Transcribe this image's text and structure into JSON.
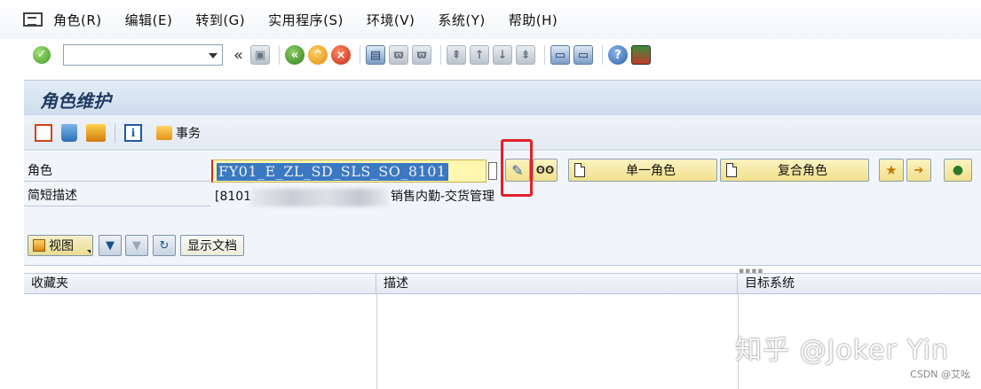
{
  "menubar": {
    "items": [
      "角色(R)",
      "编辑(E)",
      "转到(G)",
      "实用程序(S)",
      "环境(V)",
      "系统(Y)",
      "帮助(H)"
    ]
  },
  "toolbar": {
    "command_value": "",
    "chevron": "«"
  },
  "page": {
    "title": "角色维护"
  },
  "app_toolbar": {
    "transaction_label": "事务"
  },
  "form": {
    "role_label": "角色",
    "role_value": "FY01_E_ZL_SD_SLS_SO_8101",
    "desc_label": "简短描述",
    "desc_prefix": "[8101",
    "desc_suffix": "销售内勤-交货管理",
    "single_role_button": "单一角色",
    "composite_role_button": "复合角色"
  },
  "view_bar": {
    "view_button": "视图",
    "show_doc_button": "显示文档"
  },
  "table": {
    "columns": [
      "收藏夹",
      "描述",
      "目标系统"
    ]
  },
  "watermark": {
    "main": "知乎 @Joker Yin",
    "sub": "CSDN @艾吆"
  },
  "colors": {
    "highlight": "#e3202a",
    "selection": "#3a78c2",
    "field_bg": "#fff6b0"
  }
}
